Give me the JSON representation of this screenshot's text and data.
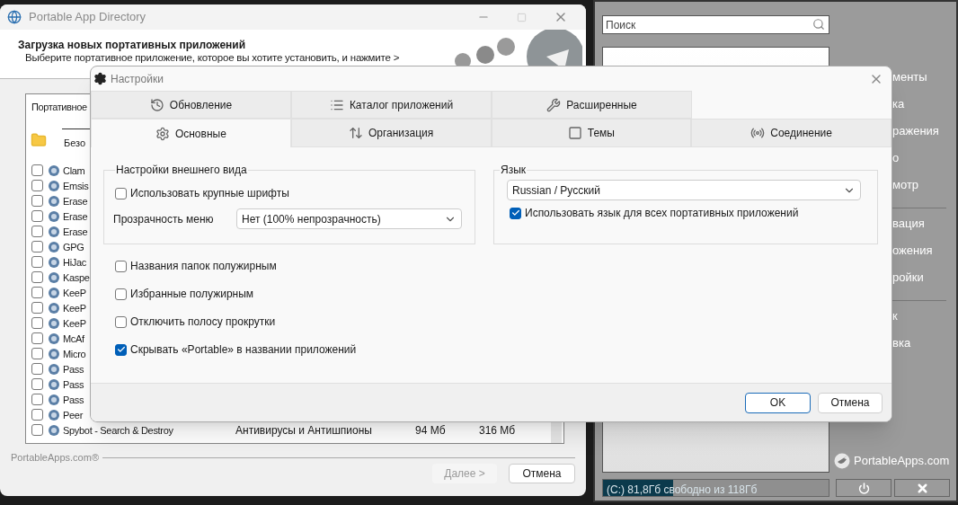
{
  "background_window": {
    "title": "Portable App Directory",
    "header_title": "Загрузка новых портативных приложений",
    "header_subtitle": "Выберите портативное приложение, которое вы хотите установить, и нажмите >",
    "list_label": "Портативное",
    "category_field": "Безо",
    "apps": [
      {
        "name": "Clam",
        "checked": false
      },
      {
        "name": "Emsis",
        "checked": false
      },
      {
        "name": "Erase",
        "checked": false
      },
      {
        "name": "Erase",
        "checked": false
      },
      {
        "name": "Erase",
        "checked": false
      },
      {
        "name": "GPG",
        "checked": false
      },
      {
        "name": "HiJac",
        "checked": false
      },
      {
        "name": "Kaspe",
        "checked": false
      },
      {
        "name": "KeeP",
        "checked": false
      },
      {
        "name": "KeeP",
        "checked": false
      },
      {
        "name": "KeeP",
        "checked": false
      },
      {
        "name": "McAf",
        "checked": false
      },
      {
        "name": "Micro",
        "checked": false
      },
      {
        "name": "Pass",
        "checked": false
      },
      {
        "name": "Pass",
        "checked": false
      },
      {
        "name": "Pass",
        "checked": false
      },
      {
        "name": "Peer",
        "checked": false
      },
      {
        "name": "Spybot - Search & Destroy",
        "category": "Антивирусы и Антишпионы",
        "download": "94 Мб",
        "size": "316 Мб",
        "checked": false
      }
    ],
    "brand": "PortableApps.com®",
    "buttons": [
      {
        "label": "Далее >",
        "disabled": true
      },
      {
        "label": "Отмена",
        "disabled": false
      }
    ]
  },
  "launcher": {
    "search": {
      "placeholder": "Поиск"
    },
    "menu_groups": [
      [
        "менты",
        "ка",
        "ражения",
        "о",
        "мотр"
      ],
      [
        "вация",
        "ожения",
        "ройки"
      ],
      [
        "к",
        "вка"
      ]
    ],
    "logo": "PortableApps.com",
    "drive": {
      "text": "(C:) 81,8Гб свободно из 118Гб",
      "level": 0.31
    }
  },
  "dialog": {
    "title": "Настройки",
    "tab_rows": [
      [
        {
          "label": "Обновление",
          "selected": false
        },
        {
          "label": "Каталог приложений",
          "selected": false
        },
        {
          "label": "Расширенные",
          "selected": false
        }
      ],
      [
        {
          "label": "Основные",
          "selected": true
        },
        {
          "label": "Организация",
          "selected": false
        },
        {
          "label": "Темы",
          "selected": false
        },
        {
          "label": "Соединение",
          "selected": false
        }
      ]
    ],
    "appearance": {
      "title": "Настройки внешнего вида",
      "large_fonts": {
        "label": "Использовать крупные шрифты",
        "checked": false
      },
      "transparency": {
        "label": "Прозрачность меню",
        "value": "Нет (100% непрозрачность)"
      }
    },
    "language": {
      "title": "Язык",
      "value": "Russian / Русский",
      "all_apps": {
        "label": "Использовать язык для всех портативных приложений",
        "checked": true
      }
    },
    "options": [
      {
        "label": "Названия папок полужирным",
        "checked": false
      },
      {
        "label": "Избранные полужирным",
        "checked": false
      },
      {
        "label": "Отключить полосу прокрутки",
        "checked": false
      },
      {
        "label": "Скрывать «Portable» в названии приложений",
        "checked": true
      }
    ],
    "buttons": [
      {
        "label": "OK",
        "default": true
      },
      {
        "label": "Отмена",
        "default": false
      }
    ]
  }
}
